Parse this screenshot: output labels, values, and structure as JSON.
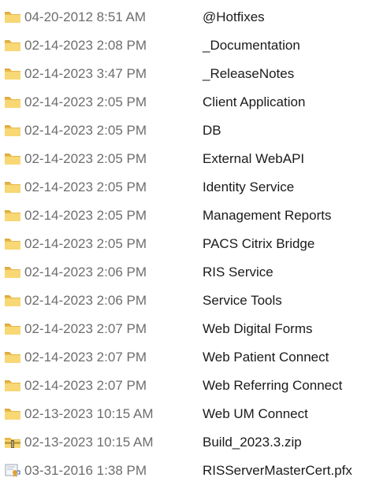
{
  "files": [
    {
      "date": "04-20-2012 8:51 AM",
      "name": "@Hotfixes",
      "icon": "folder-icon"
    },
    {
      "date": "02-14-2023 2:08 PM",
      "name": "_Documentation",
      "icon": "folder-icon"
    },
    {
      "date": "02-14-2023 3:47 PM",
      "name": "_ReleaseNotes",
      "icon": "folder-icon"
    },
    {
      "date": "02-14-2023 2:05 PM",
      "name": "Client Application",
      "icon": "folder-icon"
    },
    {
      "date": "02-14-2023 2:05 PM",
      "name": "DB",
      "icon": "folder-icon"
    },
    {
      "date": "02-14-2023 2:05 PM",
      "name": "External WebAPI",
      "icon": "folder-icon"
    },
    {
      "date": "02-14-2023 2:05 PM",
      "name": "Identity Service",
      "icon": "folder-icon"
    },
    {
      "date": "02-14-2023 2:05 PM",
      "name": "Management Reports",
      "icon": "folder-icon"
    },
    {
      "date": "02-14-2023 2:05 PM",
      "name": "PACS Citrix Bridge",
      "icon": "folder-icon"
    },
    {
      "date": "02-14-2023 2:06 PM",
      "name": "RIS Service",
      "icon": "folder-icon"
    },
    {
      "date": "02-14-2023 2:06 PM",
      "name": "Service Tools",
      "icon": "folder-icon"
    },
    {
      "date": "02-14-2023 2:07 PM",
      "name": "Web Digital Forms",
      "icon": "folder-icon"
    },
    {
      "date": "02-14-2023 2:07 PM",
      "name": "Web Patient Connect",
      "icon": "folder-icon"
    },
    {
      "date": "02-14-2023 2:07 PM",
      "name": "Web Referring Connect",
      "icon": "folder-icon"
    },
    {
      "date": "02-13-2023 10:15 AM",
      "name": "Web UM Connect",
      "icon": "folder-icon"
    },
    {
      "date": "02-13-2023 10:15 AM",
      "name": "Build_2023.3.zip",
      "icon": "zip-archive-icon"
    },
    {
      "date": "03-31-2016 1:38 PM",
      "name": "RISServerMasterCert.pfx",
      "icon": "certificate-icon"
    }
  ],
  "colors": {
    "folder_front": "#f8d775",
    "folder_back": "#e8b84a",
    "folder_tab": "#dcaa3c",
    "zip_band": "#c8a040",
    "cert_accent": "#e0a030"
  }
}
